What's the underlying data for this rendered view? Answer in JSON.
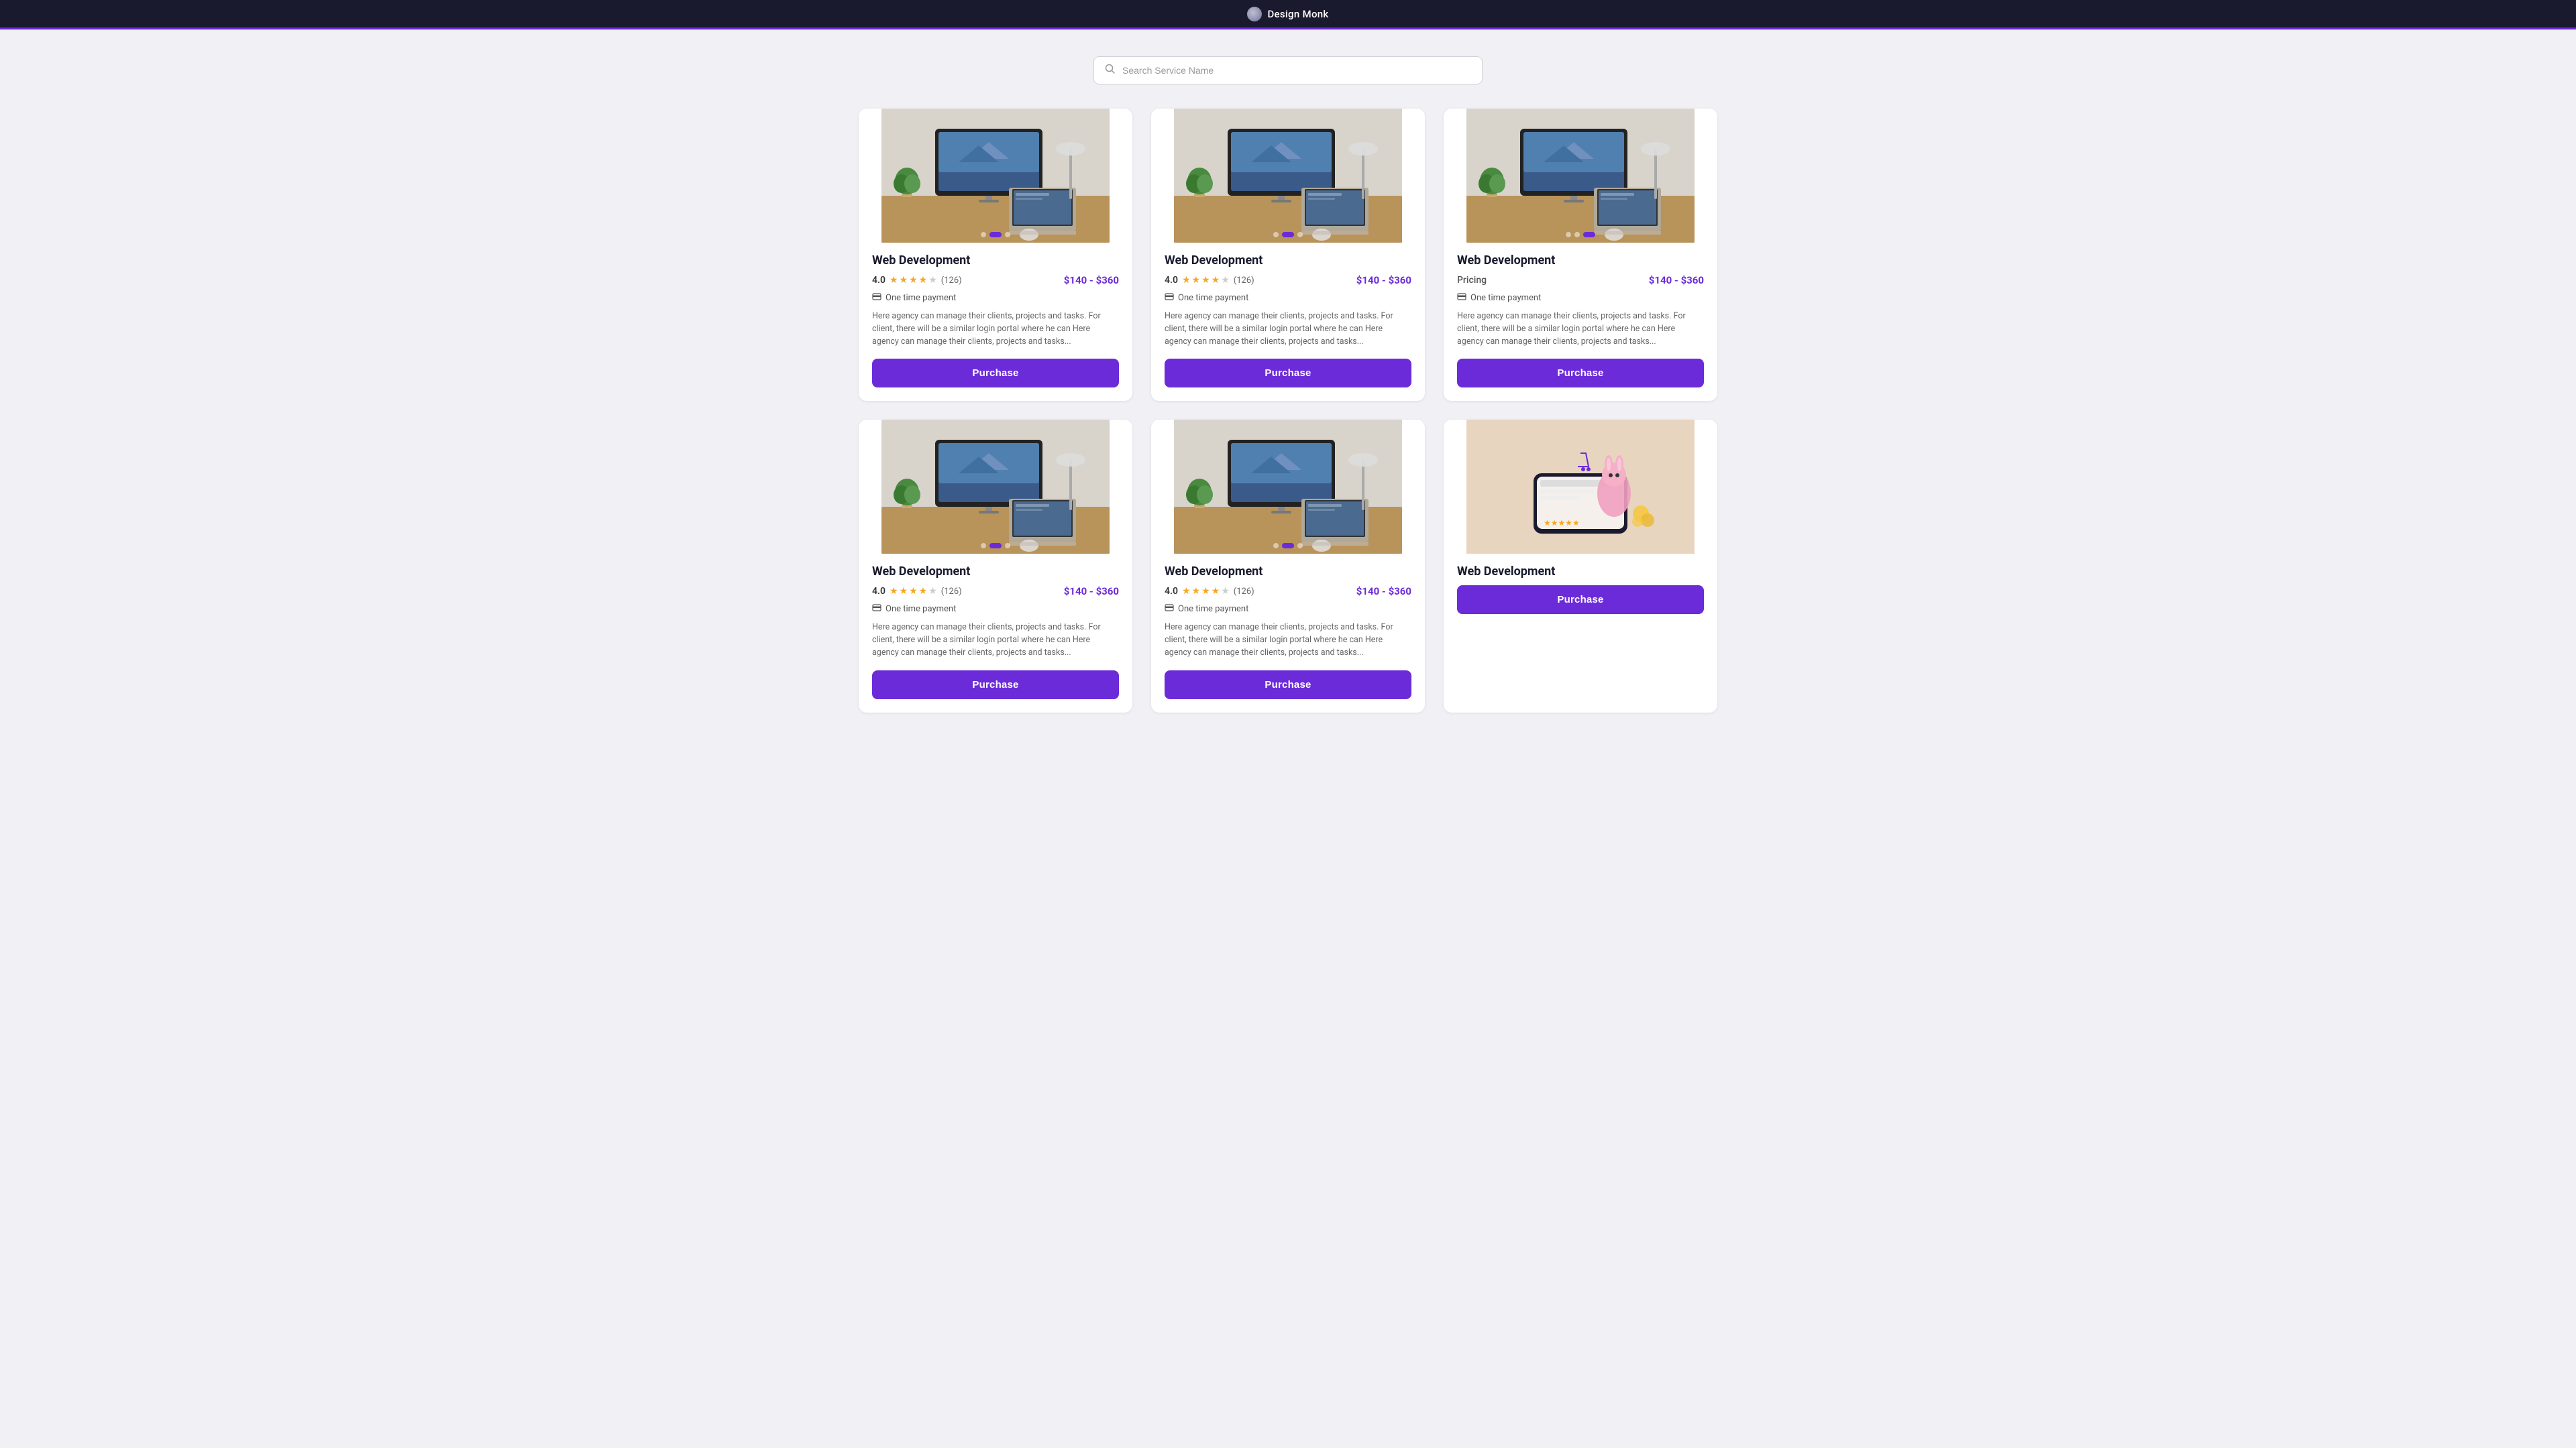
{
  "app": {
    "title": "Design Monk",
    "logo_label": "logo"
  },
  "search": {
    "placeholder": "Search Service Name"
  },
  "cards": [
    {
      "id": "card-1",
      "title": "Web Development",
      "rating": "4.0",
      "review_count": "(126)",
      "price": "$140 - $360",
      "payment_type": "One time payment",
      "pricing_label": null,
      "description": "Here agency can manage their clients, projects and tasks. For client, there will be a similar login portal where he can Here agency can manage their clients, projects and tasks...",
      "purchase_label": "Purchase",
      "image_type": "desk",
      "dots": [
        false,
        true,
        false
      ]
    },
    {
      "id": "card-2",
      "title": "Web Development",
      "rating": "4.0",
      "review_count": "(126)",
      "price": "$140 - $360",
      "payment_type": "One time payment",
      "pricing_label": null,
      "description": "Here agency can manage their clients, projects and tasks. For client, there will be a similar login portal where he can Here agency can manage their clients, projects and tasks...",
      "purchase_label": "Purchase",
      "image_type": "desk",
      "dots": [
        false,
        true,
        false
      ]
    },
    {
      "id": "card-3",
      "title": "Web Development",
      "rating": null,
      "review_count": null,
      "price": "$140 - $360",
      "payment_type": "One time payment",
      "pricing_label": "Pricing",
      "description": "Here agency can manage their clients, projects and tasks. For client, there will be a similar login portal where he can Here agency can manage their clients, projects and tasks...",
      "purchase_label": "Purchase",
      "image_type": "desk",
      "dots": [
        false,
        false,
        true
      ]
    },
    {
      "id": "card-4",
      "title": "Web Development",
      "rating": "4.0",
      "review_count": "(126)",
      "price": "$140 - $360",
      "payment_type": "One time payment",
      "pricing_label": null,
      "description": "Here agency can manage their clients, projects and tasks. For client, there will be a similar login portal where he can Here agency can manage their clients, projects and tasks...",
      "purchase_label": "Purchase",
      "image_type": "desk",
      "dots": [
        false,
        true,
        false
      ]
    },
    {
      "id": "card-5",
      "title": "Web Development",
      "rating": "4.0",
      "review_count": "(126)",
      "price": "$140 - $360",
      "payment_type": "One time payment",
      "pricing_label": null,
      "description": "Here agency can manage their clients, projects and tasks. For client, there will be a similar login portal where he can Here agency can manage their clients, projects and tasks...",
      "purchase_label": "Purchase",
      "image_type": "desk",
      "dots": [
        false,
        true,
        false
      ]
    },
    {
      "id": "card-6",
      "title": "Web Development",
      "rating": null,
      "review_count": null,
      "price": null,
      "payment_type": null,
      "pricing_label": null,
      "description": null,
      "purchase_label": "Purchase",
      "image_type": "ecom",
      "dots": []
    }
  ],
  "stars_filled": "★",
  "stars_empty": "★",
  "payment_icon": "💳"
}
